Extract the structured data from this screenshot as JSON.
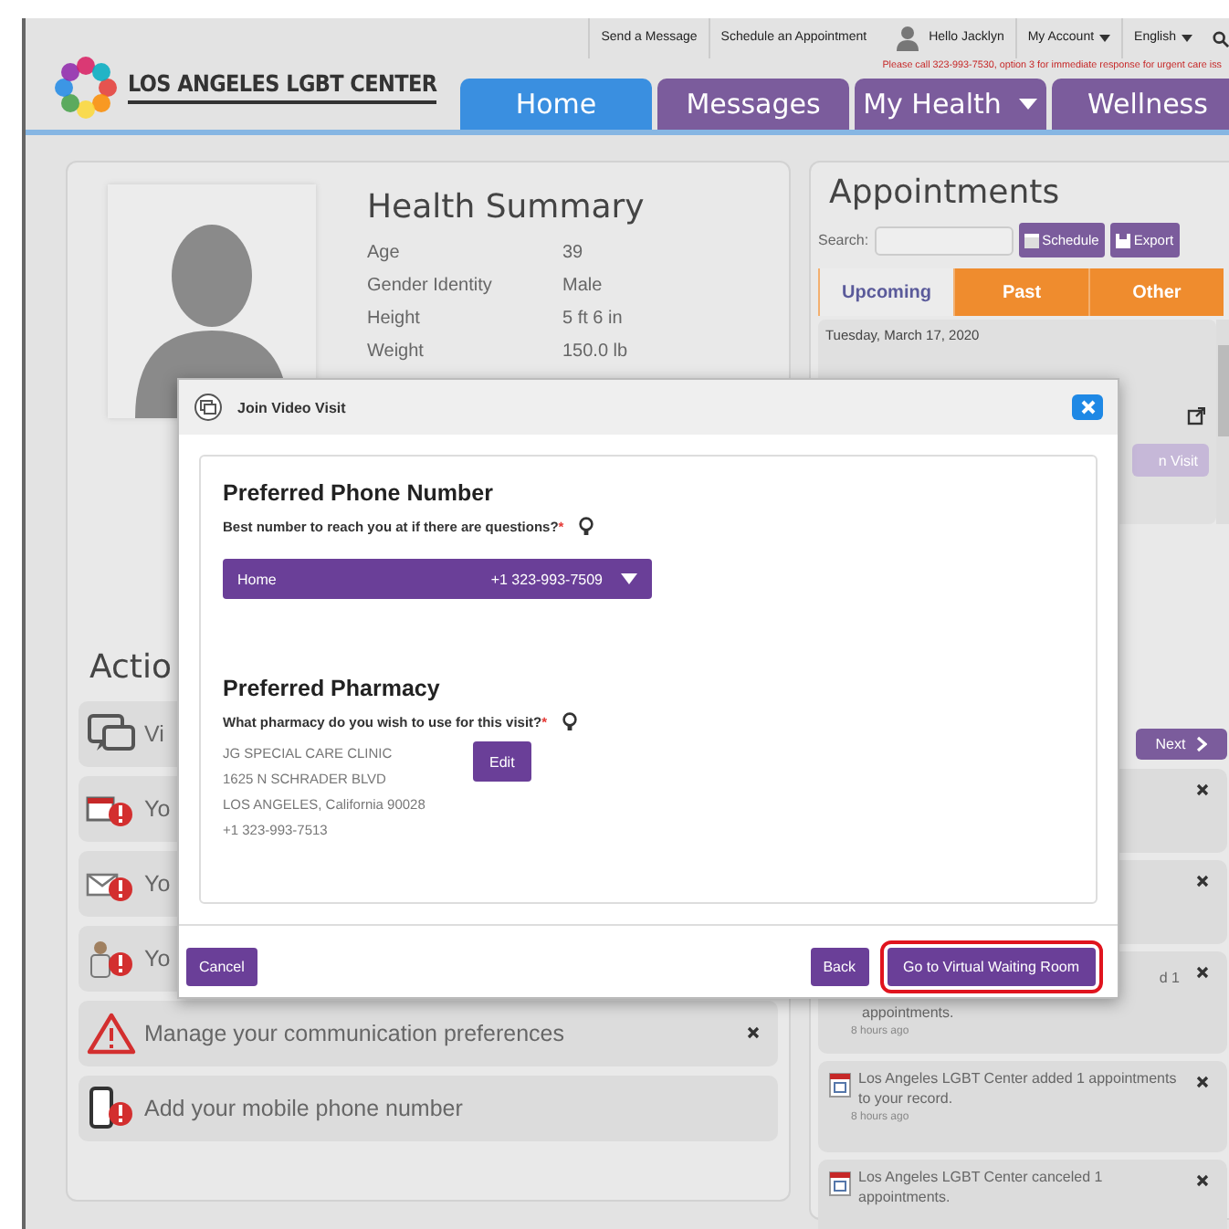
{
  "header": {
    "logo_text": "LOS ANGELES LGBT CENTER",
    "top_links": [
      "Send a Message",
      "Schedule an Appointment"
    ],
    "greeting": "Hello Jacklyn",
    "menus": [
      "My Account",
      "English"
    ],
    "notice": "Please call 323-993-7530, option 3 for immediate response for urgent care iss"
  },
  "tabs": [
    {
      "label": "Home",
      "selected": true,
      "has_menu": false
    },
    {
      "label": "Messages",
      "selected": false,
      "has_menu": false
    },
    {
      "label": "My Health",
      "selected": false,
      "has_menu": true
    },
    {
      "label": "Wellness",
      "selected": false,
      "has_menu": false
    }
  ],
  "health_summary": {
    "title": "Health Summary",
    "rows": [
      {
        "label": "Age",
        "value": "39"
      },
      {
        "label": "Gender Identity",
        "value": "Male"
      },
      {
        "label": "Height",
        "value": "5 ft 6 in"
      },
      {
        "label": "Weight",
        "value": "150.0 lb"
      }
    ]
  },
  "actions": {
    "heading": "Actio",
    "items": [
      {
        "kind": "video",
        "text": "Vi"
      },
      {
        "kind": "calendar-alert",
        "text": "Yo"
      },
      {
        "kind": "mail-alert",
        "text": "Yo"
      },
      {
        "kind": "person-alert",
        "text": "Yo"
      },
      {
        "kind": "warning",
        "text": "Manage your communication preferences",
        "dismissible": true
      },
      {
        "kind": "phone-alert",
        "text": "Add your mobile phone number",
        "dismissible": false
      }
    ]
  },
  "appointments": {
    "title": "Appointments",
    "search_label": "Search:",
    "buttons": [
      {
        "kind": "calendar",
        "label": "Schedule"
      },
      {
        "kind": "save",
        "label": "Export"
      }
    ],
    "tabs": [
      {
        "label": "Upcoming",
        "selected": true
      },
      {
        "label": "Past",
        "selected": false
      },
      {
        "label": "Other",
        "selected": false
      }
    ],
    "date": "Tuesday, March 17, 2020",
    "visit_button": "n Visit"
  },
  "notifications": {
    "next_label": "Next",
    "items": [
      {
        "dismissible": true
      },
      {
        "dismissible": true
      },
      {
        "lead": "d 1",
        "text": "appointments.",
        "time": "8 hours ago",
        "dismissible": true
      },
      {
        "text": "Los Angeles LGBT Center added 1 appointments to your record.",
        "time": "8 hours ago",
        "dismissible": true
      },
      {
        "text": "Los Angeles LGBT Center canceled 1 appointments.",
        "dismissible": true
      }
    ]
  },
  "modal": {
    "title": "Join Video Visit",
    "phone": {
      "heading": "Preferred Phone Number",
      "question": "Best number to reach you at if there are questions?",
      "required_mark": "*",
      "select": {
        "label": "Home",
        "value": "+1 323-993-7509"
      }
    },
    "pharmacy": {
      "heading": "Preferred Pharmacy",
      "question": "What pharmacy do you wish to use for this visit?",
      "required_mark": "*",
      "address": [
        "JG SPECIAL CARE CLINIC",
        "1625 N SCHRADER BLVD",
        "LOS ANGELES, California 90028",
        "+1 323-993-7513"
      ],
      "edit_label": "Edit"
    },
    "footer": [
      {
        "label": "Cancel",
        "highlighted": false
      },
      {
        "label": "Back",
        "highlighted": false
      },
      {
        "label": "Go to Virtual Waiting Room",
        "highlighted": true
      }
    ]
  }
}
